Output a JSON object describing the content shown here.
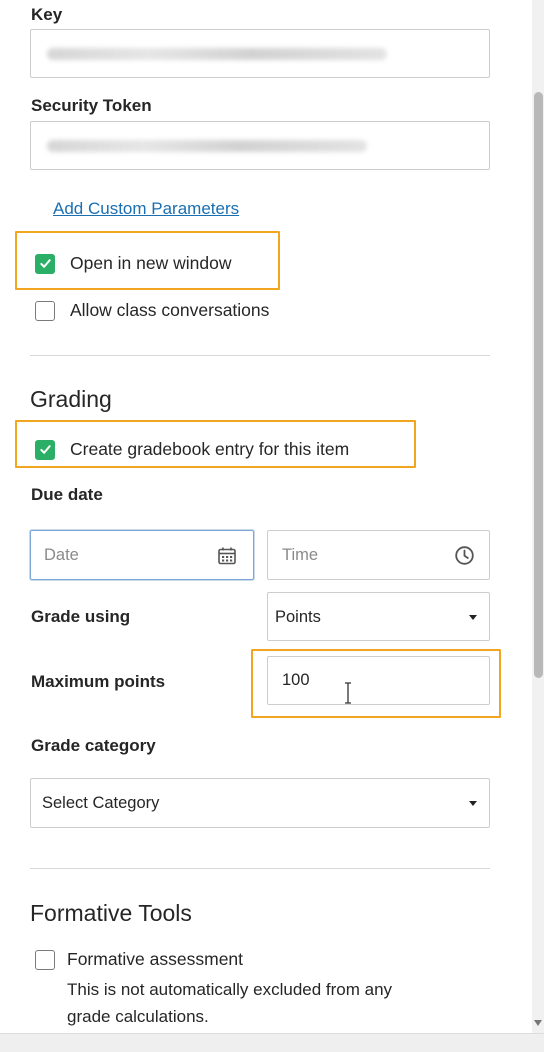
{
  "lti": {
    "key_label": "Key",
    "security_token_label": "Security Token",
    "add_custom_parameters": "Add Custom Parameters",
    "open_new_window": {
      "label": "Open in new window",
      "checked": true
    },
    "allow_conversations": {
      "label": "Allow class conversations",
      "checked": false
    }
  },
  "grading": {
    "title": "Grading",
    "create_gradebook": {
      "label": "Create gradebook entry for this item",
      "checked": true
    },
    "due_date_label": "Due date",
    "date_placeholder": "Date",
    "time_placeholder": "Time",
    "grade_using_label": "Grade using",
    "grade_using_value": "Points",
    "max_points_label": "Maximum points",
    "max_points_value": "100",
    "grade_category_label": "Grade category",
    "grade_category_value": "Select Category"
  },
  "formative": {
    "title": "Formative Tools",
    "assessment": {
      "label": "Formative assessment",
      "checked": false,
      "note_line1": "This is not automatically excluded from any",
      "note_line2": "grade calculations."
    }
  },
  "icons": {
    "check": "check-icon",
    "calendar": "calendar-icon",
    "clock": "clock-icon",
    "dropdown": "caret-down-icon"
  },
  "colors": {
    "checkbox_checked": "#2bae66",
    "highlight": "#f2a51e",
    "link": "#1a6fb0",
    "date_focus": "#7fa7d6"
  }
}
